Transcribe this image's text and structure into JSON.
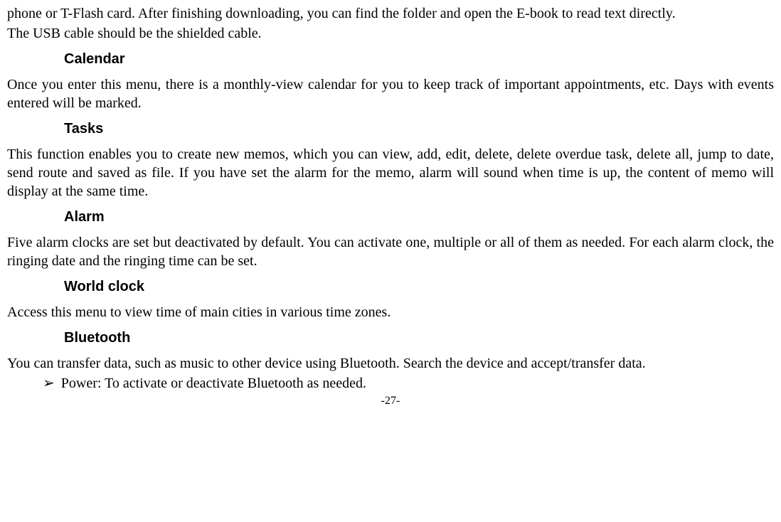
{
  "intro": {
    "p1": "phone or T-Flash card. After finishing downloading, you can find the folder and open the E-book to read text directly.",
    "p2": "The USB cable should be the shielded cable."
  },
  "sections": {
    "calendar": {
      "title": "Calendar",
      "body": "Once you enter this menu, there is a monthly-view calendar for you to keep track of important appointments, etc. Days with events entered will be marked."
    },
    "tasks": {
      "title": "Tasks",
      "body": "This function enables you to create new memos, which you can view, add, edit, delete, delete overdue task, delete all, jump to date, send route and saved as file. If you have set the alarm for the memo, alarm will sound when time is up, the content of memo will display at the same time."
    },
    "alarm": {
      "title": "Alarm",
      "body": "Five alarm clocks are set but deactivated by default. You can activate one, multiple or all of them as needed. For each alarm clock, the ringing date and the ringing time can be set."
    },
    "world_clock": {
      "title": "World clock",
      "body": "Access this menu to view time of main cities in various time zones."
    },
    "bluetooth": {
      "title": "Bluetooth",
      "body": "You can transfer data, such as music to other device using Bluetooth. Search the device and accept/transfer data.",
      "bullet_marker": "➢",
      "bullet1": "Power: To activate or deactivate Bluetooth as needed."
    }
  },
  "page_number": "-27-"
}
